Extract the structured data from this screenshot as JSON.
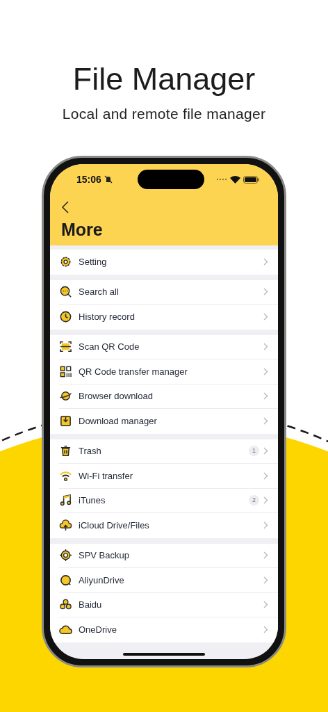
{
  "hero": {
    "title": "File Manager",
    "subtitle": "Local and remote file manager"
  },
  "status_bar": {
    "time": "15:06"
  },
  "nav": {
    "title": "More"
  },
  "groups": [
    {
      "items": [
        {
          "label": "Setting"
        }
      ]
    },
    {
      "items": [
        {
          "label": "Search all"
        },
        {
          "label": "History record"
        }
      ]
    },
    {
      "items": [
        {
          "label": "Scan QR Code"
        },
        {
          "label": "QR Code transfer manager"
        },
        {
          "label": "Browser download"
        },
        {
          "label": "Download manager"
        }
      ]
    },
    {
      "items": [
        {
          "label": "Trash",
          "badge": "1"
        },
        {
          "label": "Wi-Fi transfer"
        },
        {
          "label": "iTunes",
          "badge": "2"
        },
        {
          "label": "iCloud Drive/Files"
        }
      ]
    },
    {
      "items": [
        {
          "label": "SPV Backup"
        },
        {
          "label": "AliyunDrive"
        },
        {
          "label": "Baidu"
        },
        {
          "label": "OneDrive"
        }
      ]
    }
  ]
}
